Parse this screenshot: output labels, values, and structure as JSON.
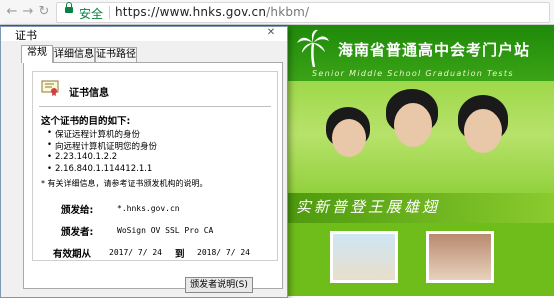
{
  "browser": {
    "back_icon": "back-arrow-icon",
    "forward_icon": "forward-arrow-icon",
    "reload_icon": "reload-icon",
    "secure_label": "安全",
    "url_host": "https://www.hnks.gov.cn",
    "url_path": "/hkbm/"
  },
  "site": {
    "title": "海南省普通高中会考门户站",
    "subtitle": "Senior Middle School Graduation Tests",
    "slogan": "实新普登王展雄翅"
  },
  "dialog": {
    "title": "证书",
    "tabs": [
      {
        "label": "常规"
      },
      {
        "label": "详细信息"
      },
      {
        "label": "证书路径"
      }
    ],
    "heading": "证书信息",
    "purpose_title": "这个证书的目的如下:",
    "purposes": [
      "保证远程计算机的身份",
      "向远程计算机证明您的身份",
      "2.23.140.1.2.2",
      "2.16.840.1.114412.1.1"
    ],
    "note": "* 有关详细信息，请参考证书颁发机构的说明。",
    "issued_to_label": "颁发给:",
    "issued_to_value": "*.hnks.gov.cn",
    "issued_by_label": "颁发者:",
    "issued_by_value": "WoSign OV SSL Pro CA",
    "valid_label": "有效期从",
    "valid_from": "2017/ 7/ 24",
    "valid_to_word": "到",
    "valid_to": "2018/ 7/ 24",
    "issuer_statement_button": "颁发者说明(S)"
  }
}
